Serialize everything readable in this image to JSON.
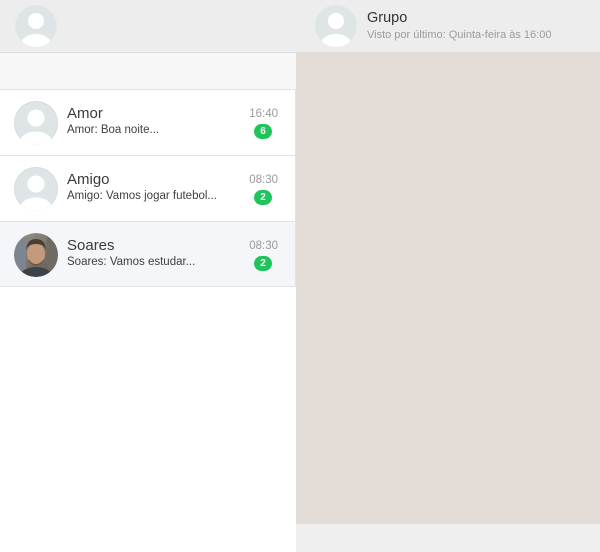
{
  "sidebar": {
    "profile_avatar_icon": "default-user-avatar-icon",
    "chats": [
      {
        "name": "Amor",
        "preview": "Amor: Boa noite...",
        "time": "16:40",
        "unread": "6",
        "avatar": "default-user-avatar-icon"
      },
      {
        "name": "Amigo",
        "preview": "Amigo: Vamos jogar futebol...",
        "time": "08:30",
        "unread": "2",
        "avatar": "default-user-avatar-icon"
      },
      {
        "name": "Soares",
        "preview": "Soares: Vamos estudar...",
        "time": "08:30",
        "unread": "2",
        "avatar": "user-photo"
      }
    ]
  },
  "conversation": {
    "contact_name": "Grupo",
    "last_seen": "Visto por último: Quinta-feira às 16:00",
    "avatar": "default-user-avatar-icon"
  },
  "colors": {
    "header_bg": "#ededed",
    "chat_background": "#e4dcd6",
    "unread_badge": "#1fc45a",
    "active_chat_bg": "#f4f6f9"
  }
}
